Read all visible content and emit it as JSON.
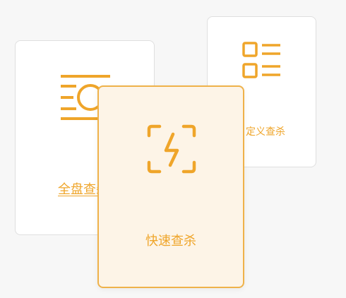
{
  "scan_modes": {
    "full": {
      "label": "全盘查杀",
      "icon": "full-scan-icon"
    },
    "custom": {
      "label": "定义查杀",
      "icon": "list-icon"
    },
    "quick": {
      "label": "快速查杀",
      "icon": "lightning-scan-icon",
      "selected": true
    }
  },
  "colors": {
    "accent": "#efa52a",
    "selected_bg": "#fdf4e7",
    "card_bg": "#ffffff",
    "card_border": "#dfdfdf",
    "page_bg": "#f7f7f7"
  }
}
